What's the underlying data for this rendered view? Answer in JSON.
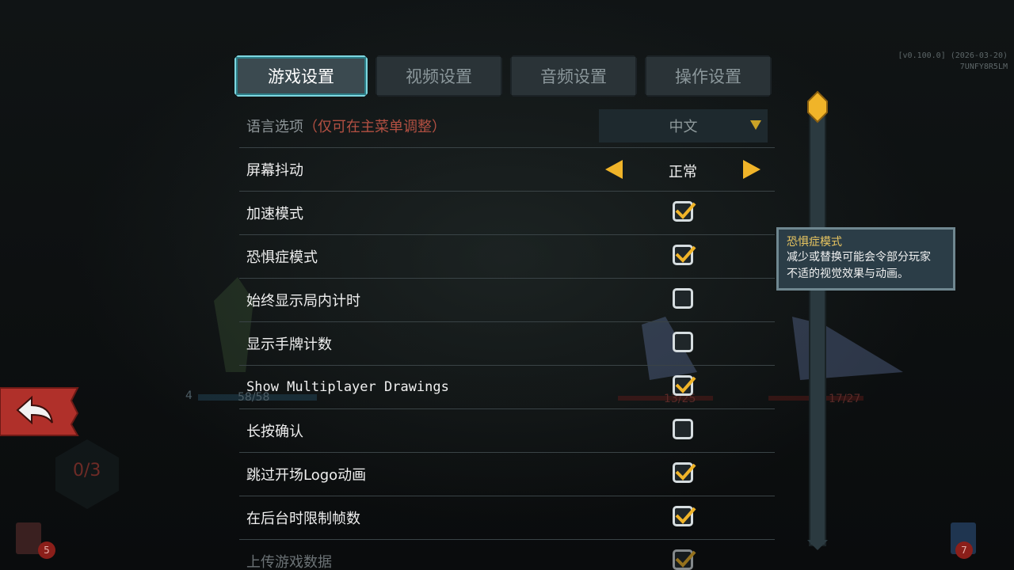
{
  "version": {
    "line1": "[v0.100.0] (2026-03-20)",
    "line2": "7UNFY8R5LM"
  },
  "tabs": [
    {
      "label": "游戏设置",
      "active": true
    },
    {
      "label": "视频设置",
      "active": false
    },
    {
      "label": "音频设置",
      "active": false
    },
    {
      "label": "操作设置",
      "active": false
    }
  ],
  "settings": {
    "language": {
      "label": "语言选项",
      "note": "（仅可在主菜单调整）",
      "value": "中文"
    },
    "screen_shake": {
      "label": "屏幕抖动",
      "value": "正常"
    },
    "fast_mode": {
      "label": "加速模式",
      "checked": true
    },
    "phobia_mode": {
      "label": "恐惧症模式",
      "checked": true
    },
    "always_show_timer": {
      "label": "始终显示局内计时",
      "checked": false
    },
    "show_card_count": {
      "label": "显示手牌计数",
      "checked": false
    },
    "multiplayer_drawings": {
      "label": "Show Multiplayer Drawings",
      "checked": true
    },
    "long_press_confirm": {
      "label": "长按确认",
      "checked": false
    },
    "skip_logo": {
      "label": "跳过开场Logo动画",
      "checked": true
    },
    "limit_fps_background": {
      "label": "在后台时限制帧数",
      "checked": true
    },
    "upload_data": {
      "label": "上传游戏数据",
      "checked": true
    }
  },
  "tooltip": {
    "title": "恐惧症模式",
    "body_line1": "减少或替换可能会令部分玩家",
    "body_line2": "不适的视觉效果与动画。"
  },
  "background": {
    "player_hp": "58/58",
    "player_block": "4",
    "enemy1_hp": "13/25",
    "enemy2_hp": "17/27",
    "energy": "0/3",
    "draw_pile": "5",
    "discard_pile": "7"
  },
  "colors": {
    "accent": "#7ed6df",
    "checkmark": "#f0b429",
    "back_button": "#b0302a",
    "tooltip_title": "#e8c560"
  }
}
